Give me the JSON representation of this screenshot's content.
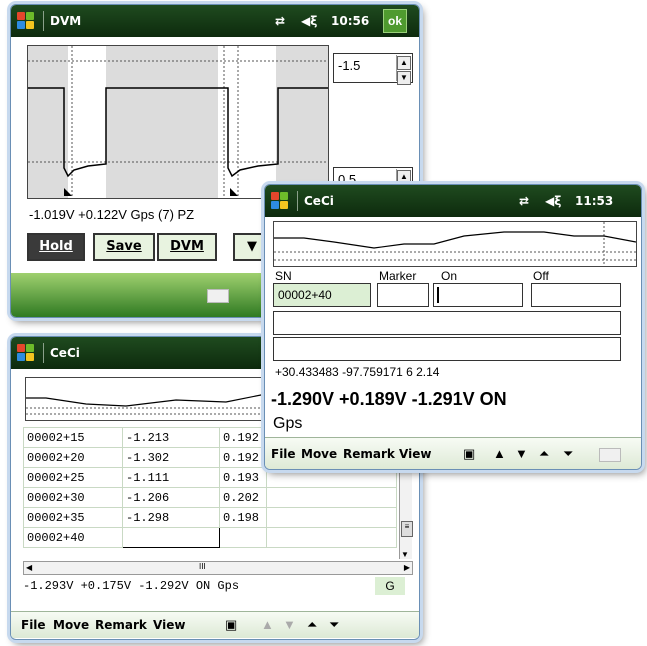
{
  "dvm": {
    "title": "DVM",
    "time": "10:56",
    "ok": "ok",
    "signal_icon": "⇄",
    "volume_icon": "◀ξ",
    "spin_top": "-1.5",
    "spin_bottom": "0.5",
    "readout": "-1.019V  +0.122V Gps (7) PZ",
    "buttons": {
      "hold": "Hold",
      "save": "Save",
      "dvm": "DVM"
    },
    "dropdown_arrow": "▼"
  },
  "ceci_front": {
    "title": "CeCi",
    "time": "11:53",
    "labels": {
      "sn": "SN",
      "marker": "Marker",
      "on": "On",
      "off": "Off"
    },
    "sn_value": "00002+40",
    "coords": "+30.433483   -97.759171   6  2.14",
    "big_readout": "-1.290V  +0.189V  -1.291V ON",
    "gps": "Gps",
    "menu": [
      "File",
      "Move",
      "Remark",
      "View"
    ]
  },
  "ceci_back": {
    "title": "CeCi",
    "rows": [
      {
        "sn": "00002+15",
        "on": "-1.213",
        "off": "0.192"
      },
      {
        "sn": "00002+20",
        "on": "-1.302",
        "off": "0.192"
      },
      {
        "sn": "00002+25",
        "on": "-1.111",
        "off": "0.193"
      },
      {
        "sn": "00002+30",
        "on": "-1.206",
        "off": "0.202"
      },
      {
        "sn": "00002+35",
        "on": "-1.298",
        "off": "0.198"
      },
      {
        "sn": "00002+40",
        "on": "",
        "off": ""
      }
    ],
    "status": "-1.293V  +0.175V  -1.292V ON  Gps",
    "status_g": "G",
    "menu": [
      "File",
      "Move",
      "Remark",
      "View"
    ],
    "hscroll_thumb": "III"
  },
  "colors": {
    "title_bg": "#0d2a0d",
    "ok_green": "#4f9a2f",
    "sn_field": "#dcefd4"
  }
}
